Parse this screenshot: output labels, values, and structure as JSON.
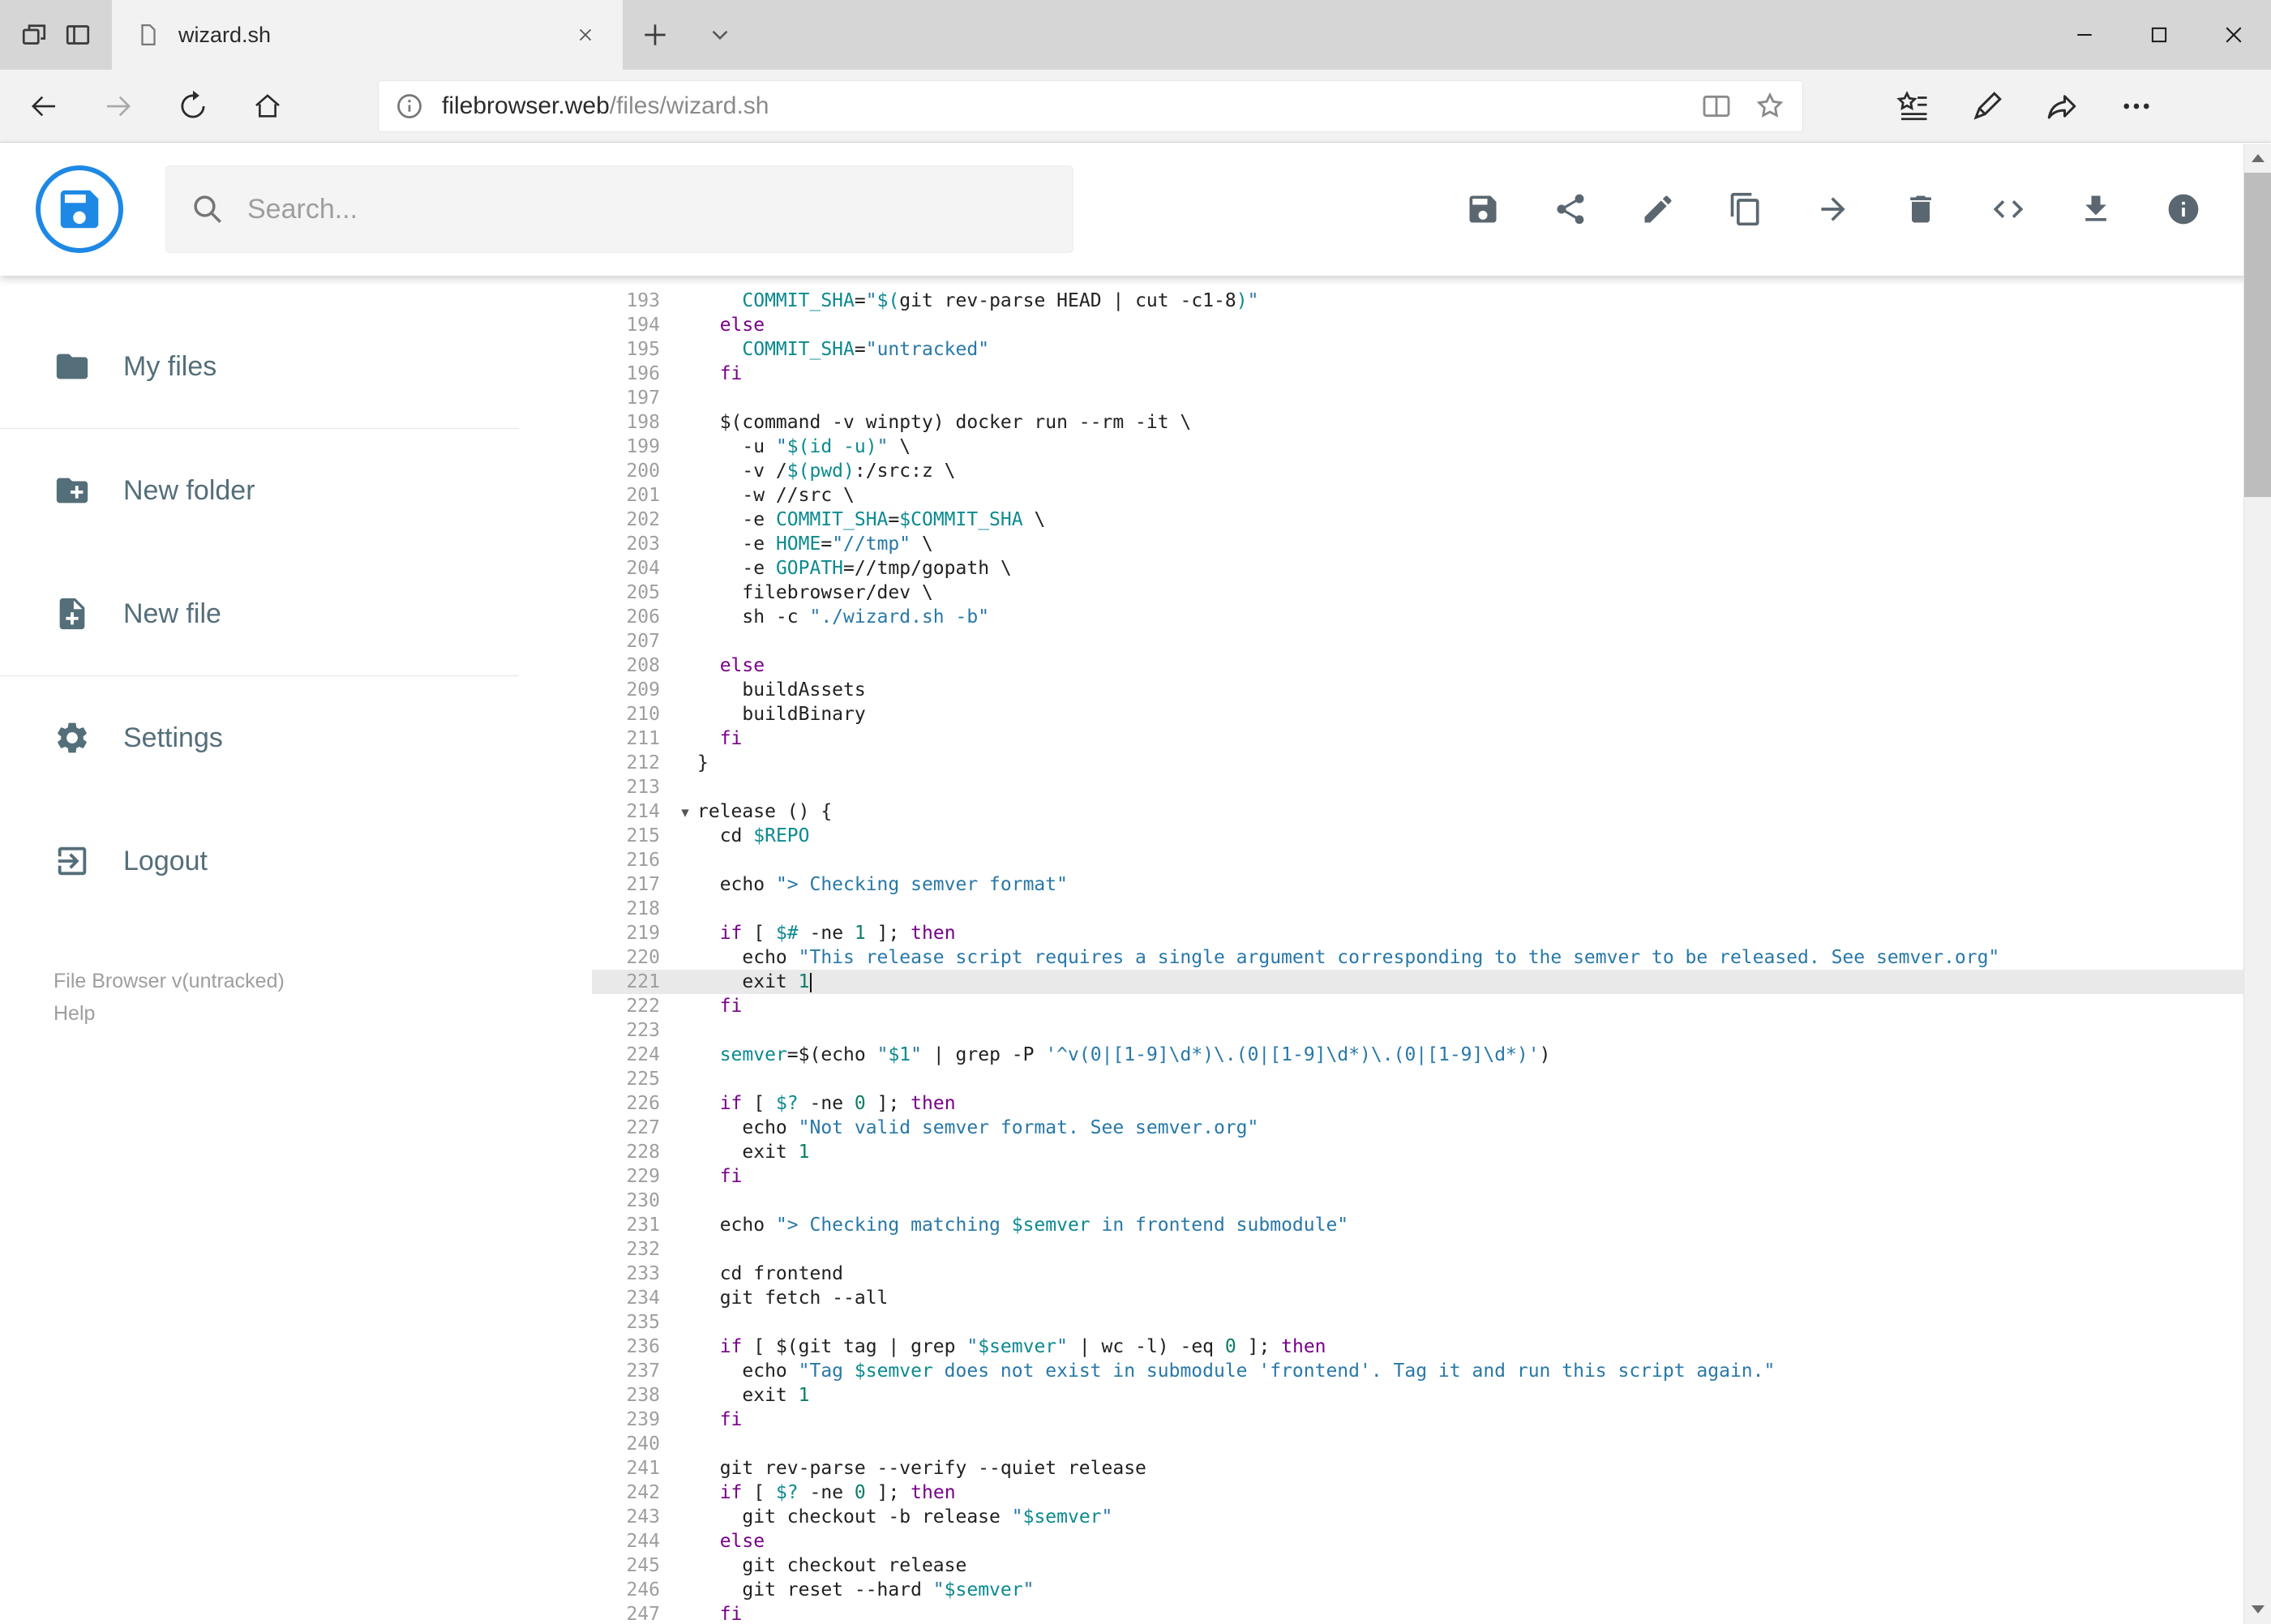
{
  "colors": {
    "accent": "#1e88e5",
    "kw": "#770088",
    "str": "#2878a8",
    "vr": "#0c8a8f",
    "num": "#0b7d66",
    "txt": "#212121",
    "gutter": "#9e9e9e",
    "active": "#e9e9e9"
  },
  "browser": {
    "tab_title": "wizard.sh",
    "url_host": "filebrowser.web",
    "url_path": "/files/wizard.sh",
    "left_icons": [
      "set-tabs-aside-icon",
      "tab-preview-icon"
    ],
    "nav_icons": [
      "back",
      "forward",
      "refresh",
      "home"
    ],
    "address_icons": [
      "info",
      "reading-view",
      "favorite-star"
    ],
    "right_icons": [
      "hub",
      "web-note-pen",
      "share",
      "more"
    ],
    "window_controls": [
      "minimize",
      "maximize",
      "close"
    ]
  },
  "header": {
    "search_placeholder": "Search...",
    "toolbar_icons": [
      "save",
      "share",
      "edit",
      "copy",
      "move",
      "delete",
      "raw-view",
      "download",
      "info"
    ]
  },
  "sidebar": {
    "items": [
      {
        "label": "My files",
        "icon": "folder"
      },
      {
        "label": "New folder",
        "icon": "create-new-folder"
      },
      {
        "label": "New file",
        "icon": "note-add"
      },
      {
        "label": "Settings",
        "icon": "settings-gear"
      },
      {
        "label": "Logout",
        "icon": "logout"
      }
    ],
    "footer_version": "File Browser v(untracked)",
    "footer_help": "Help"
  },
  "editor": {
    "active_line": 221,
    "lines": [
      {
        "n": 193,
        "t": [
          [
            "d",
            "    "
          ],
          [
            "v",
            "COMMIT_SHA"
          ],
          [
            "d",
            "="
          ],
          [
            "s",
            "\""
          ],
          [
            "v",
            "$("
          ],
          [
            "d",
            "git rev-parse HEAD | cut -c1-8"
          ],
          [
            "v",
            ")"
          ],
          [
            "s",
            "\""
          ]
        ]
      },
      {
        "n": 194,
        "t": [
          [
            "d",
            "  "
          ],
          [
            "k",
            "else"
          ]
        ]
      },
      {
        "n": 195,
        "t": [
          [
            "d",
            "    "
          ],
          [
            "v",
            "COMMIT_SHA"
          ],
          [
            "d",
            "="
          ],
          [
            "s",
            "\"untracked\""
          ]
        ]
      },
      {
        "n": 196,
        "t": [
          [
            "d",
            "  "
          ],
          [
            "k",
            "fi"
          ]
        ]
      },
      {
        "n": 197,
        "t": []
      },
      {
        "n": 198,
        "t": [
          [
            "d",
            "  $(command -v winpty) docker run --rm -it \\"
          ]
        ]
      },
      {
        "n": 199,
        "t": [
          [
            "d",
            "    -u "
          ],
          [
            "s",
            "\""
          ],
          [
            "v",
            "$(id -u)"
          ],
          [
            "s",
            "\""
          ],
          [
            "d",
            " \\"
          ]
        ]
      },
      {
        "n": 200,
        "t": [
          [
            "d",
            "    -v /"
          ],
          [
            "v",
            "$(pwd)"
          ],
          [
            "d",
            ":/src:z \\"
          ]
        ]
      },
      {
        "n": 201,
        "t": [
          [
            "d",
            "    -w //src \\"
          ]
        ]
      },
      {
        "n": 202,
        "t": [
          [
            "d",
            "    -e "
          ],
          [
            "v",
            "COMMIT_SHA"
          ],
          [
            "d",
            "="
          ],
          [
            "v",
            "$COMMIT_SHA"
          ],
          [
            "d",
            " \\"
          ]
        ]
      },
      {
        "n": 203,
        "t": [
          [
            "d",
            "    -e "
          ],
          [
            "v",
            "HOME"
          ],
          [
            "d",
            "="
          ],
          [
            "s",
            "\"//tmp\""
          ],
          [
            "d",
            " \\"
          ]
        ]
      },
      {
        "n": 204,
        "t": [
          [
            "d",
            "    -e "
          ],
          [
            "v",
            "GOPATH"
          ],
          [
            "d",
            "=//tmp/gopath \\"
          ]
        ]
      },
      {
        "n": 205,
        "t": [
          [
            "d",
            "    filebrowser/dev \\"
          ]
        ]
      },
      {
        "n": 206,
        "t": [
          [
            "d",
            "    sh -c "
          ],
          [
            "s",
            "\"./wizard.sh -b\""
          ]
        ]
      },
      {
        "n": 207,
        "t": []
      },
      {
        "n": 208,
        "t": [
          [
            "d",
            "  "
          ],
          [
            "k",
            "else"
          ]
        ]
      },
      {
        "n": 209,
        "t": [
          [
            "d",
            "    buildAssets"
          ]
        ]
      },
      {
        "n": 210,
        "t": [
          [
            "d",
            "    buildBinary"
          ]
        ]
      },
      {
        "n": 211,
        "t": [
          [
            "d",
            "  "
          ],
          [
            "k",
            "fi"
          ]
        ]
      },
      {
        "n": 212,
        "t": [
          [
            "d",
            "}"
          ]
        ]
      },
      {
        "n": 213,
        "t": []
      },
      {
        "n": 214,
        "f": true,
        "t": [
          [
            "d",
            "release () {"
          ]
        ]
      },
      {
        "n": 215,
        "t": [
          [
            "d",
            "  cd "
          ],
          [
            "v",
            "$REPO"
          ]
        ]
      },
      {
        "n": 216,
        "t": []
      },
      {
        "n": 217,
        "t": [
          [
            "d",
            "  echo "
          ],
          [
            "s",
            "\"> Checking semver format\""
          ]
        ]
      },
      {
        "n": 218,
        "t": []
      },
      {
        "n": 219,
        "t": [
          [
            "d",
            "  "
          ],
          [
            "k",
            "if"
          ],
          [
            "d",
            " [ "
          ],
          [
            "v",
            "$#"
          ],
          [
            "d",
            " -ne "
          ],
          [
            "m",
            "1"
          ],
          [
            "d",
            " ]; "
          ],
          [
            "k",
            "then"
          ]
        ]
      },
      {
        "n": 220,
        "t": [
          [
            "d",
            "    echo "
          ],
          [
            "s",
            "\"This release script requires a single argument corresponding to the semver to be released. See semver.org\""
          ]
        ]
      },
      {
        "n": 221,
        "t": [
          [
            "d",
            "    exit "
          ],
          [
            "m",
            "1"
          ]
        ]
      },
      {
        "n": 222,
        "t": [
          [
            "d",
            "  "
          ],
          [
            "k",
            "fi"
          ]
        ]
      },
      {
        "n": 223,
        "t": []
      },
      {
        "n": 224,
        "t": [
          [
            "d",
            "  "
          ],
          [
            "v",
            "semver"
          ],
          [
            "d",
            "=$(echo "
          ],
          [
            "s",
            "\""
          ],
          [
            "v",
            "$1"
          ],
          [
            "s",
            "\""
          ],
          [
            "d",
            " | grep -P "
          ],
          [
            "s",
            "'^v(0|[1-9]\\d*)\\.(0|[1-9]\\d*)\\.(0|[1-9]\\d*)'"
          ],
          [
            "d",
            ")"
          ]
        ]
      },
      {
        "n": 225,
        "t": []
      },
      {
        "n": 226,
        "t": [
          [
            "d",
            "  "
          ],
          [
            "k",
            "if"
          ],
          [
            "d",
            " [ "
          ],
          [
            "v",
            "$?"
          ],
          [
            "d",
            " -ne "
          ],
          [
            "m",
            "0"
          ],
          [
            "d",
            " ]; "
          ],
          [
            "k",
            "then"
          ]
        ]
      },
      {
        "n": 227,
        "t": [
          [
            "d",
            "    echo "
          ],
          [
            "s",
            "\"Not valid semver format. See semver.org\""
          ]
        ]
      },
      {
        "n": 228,
        "t": [
          [
            "d",
            "    exit "
          ],
          [
            "m",
            "1"
          ]
        ]
      },
      {
        "n": 229,
        "t": [
          [
            "d",
            "  "
          ],
          [
            "k",
            "fi"
          ]
        ]
      },
      {
        "n": 230,
        "t": []
      },
      {
        "n": 231,
        "t": [
          [
            "d",
            "  echo "
          ],
          [
            "s",
            "\"> Checking matching "
          ],
          [
            "v",
            "$semver"
          ],
          [
            "s",
            " in frontend submodule\""
          ]
        ]
      },
      {
        "n": 232,
        "t": []
      },
      {
        "n": 233,
        "t": [
          [
            "d",
            "  cd frontend"
          ]
        ]
      },
      {
        "n": 234,
        "t": [
          [
            "d",
            "  git fetch --all"
          ]
        ]
      },
      {
        "n": 235,
        "t": []
      },
      {
        "n": 236,
        "t": [
          [
            "d",
            "  "
          ],
          [
            "k",
            "if"
          ],
          [
            "d",
            " [ $(git tag | grep "
          ],
          [
            "s",
            "\""
          ],
          [
            "v",
            "$semver"
          ],
          [
            "s",
            "\""
          ],
          [
            "d",
            " | wc -l) -eq "
          ],
          [
            "m",
            "0"
          ],
          [
            "d",
            " ]; "
          ],
          [
            "k",
            "then"
          ]
        ]
      },
      {
        "n": 237,
        "t": [
          [
            "d",
            "    echo "
          ],
          [
            "s",
            "\"Tag "
          ],
          [
            "v",
            "$semver"
          ],
          [
            "s",
            " does not exist in submodule 'frontend'. Tag it and run this script again.\""
          ]
        ]
      },
      {
        "n": 238,
        "t": [
          [
            "d",
            "    exit "
          ],
          [
            "m",
            "1"
          ]
        ]
      },
      {
        "n": 239,
        "t": [
          [
            "d",
            "  "
          ],
          [
            "k",
            "fi"
          ]
        ]
      },
      {
        "n": 240,
        "t": []
      },
      {
        "n": 241,
        "t": [
          [
            "d",
            "  git rev-parse --verify --quiet release"
          ]
        ]
      },
      {
        "n": 242,
        "t": [
          [
            "d",
            "  "
          ],
          [
            "k",
            "if"
          ],
          [
            "d",
            " [ "
          ],
          [
            "v",
            "$?"
          ],
          [
            "d",
            " -ne "
          ],
          [
            "m",
            "0"
          ],
          [
            "d",
            " ]; "
          ],
          [
            "k",
            "then"
          ]
        ]
      },
      {
        "n": 243,
        "t": [
          [
            "d",
            "    git checkout -b release "
          ],
          [
            "s",
            "\""
          ],
          [
            "v",
            "$semver"
          ],
          [
            "s",
            "\""
          ]
        ]
      },
      {
        "n": 244,
        "t": [
          [
            "d",
            "  "
          ],
          [
            "k",
            "else"
          ]
        ]
      },
      {
        "n": 245,
        "t": [
          [
            "d",
            "    git checkout release"
          ]
        ]
      },
      {
        "n": 246,
        "t": [
          [
            "d",
            "    git reset --hard "
          ],
          [
            "s",
            "\""
          ],
          [
            "v",
            "$semver"
          ],
          [
            "s",
            "\""
          ]
        ]
      },
      {
        "n": 247,
        "t": [
          [
            "d",
            "  "
          ],
          [
            "k",
            "fi"
          ]
        ]
      }
    ]
  }
}
